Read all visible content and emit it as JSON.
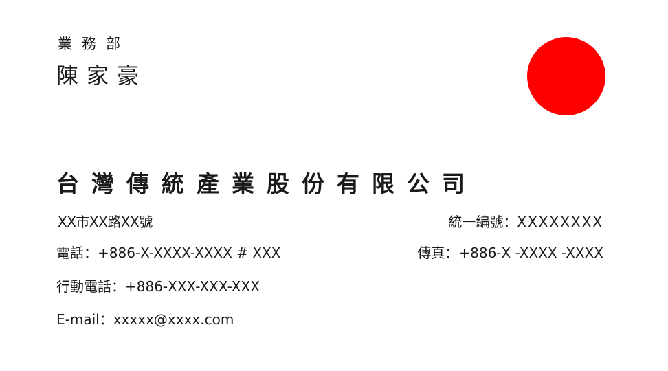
{
  "card": {
    "department": "業務部",
    "name": "陳家豪",
    "company": "台灣傳統產業股份有限公司",
    "address": "XX市XX路XX號",
    "tax_id": {
      "label": "統一編號：",
      "value": "XXXXXXXX"
    },
    "phone": {
      "label": "電話：",
      "value": "+886-X-XXXX-XXXX # XXX"
    },
    "fax": {
      "label": "傳真：",
      "value": "+886-X -XXXX -XXXX"
    },
    "mobile": {
      "label": "行動電話：",
      "value": "+886-XXX-XXX-XXX"
    },
    "email": {
      "label": "E-mail：",
      "value": "xxxxx@xxxx.com"
    }
  },
  "colors": {
    "logo": "#ff0000",
    "text": "#1a1a1a",
    "background": "#ffffff"
  },
  "icons": {
    "logo": "red-circle-logo-icon"
  }
}
